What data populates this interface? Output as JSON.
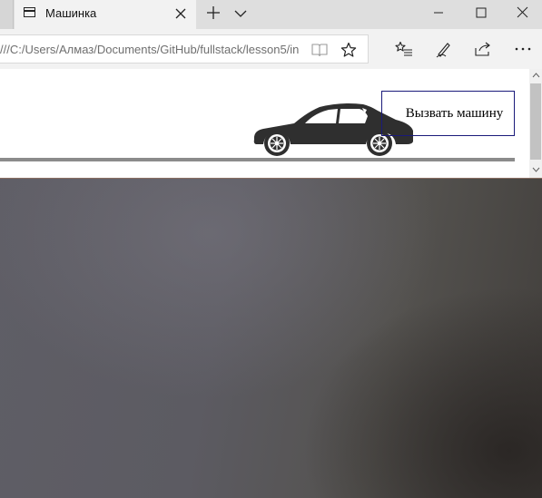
{
  "browser": {
    "tab": {
      "title": "Машинка"
    },
    "address": {
      "url": "///C:/Users/Алмаз/Documents/GitHub/fullstack/lesson5/in"
    },
    "icons": {
      "tab_page": "page-icon",
      "tab_close": "close-icon",
      "new_tab": "plus-icon",
      "tab_list": "chevron-down-icon",
      "minimize": "minimize-icon",
      "maximize": "maximize-icon",
      "close_window": "close-window-icon",
      "reading_view": "book-icon",
      "favorite": "star-icon",
      "favorites_hub": "favorites-list-icon",
      "web_note": "pen-icon",
      "share": "share-icon",
      "more": "more-icon"
    }
  },
  "page": {
    "call_button_label": "Вызвать машину",
    "car_image": "car-icon"
  },
  "colors": {
    "road": "#8b8b8b",
    "button_border": "#1a1a7a",
    "car": "#2f2f2f"
  }
}
